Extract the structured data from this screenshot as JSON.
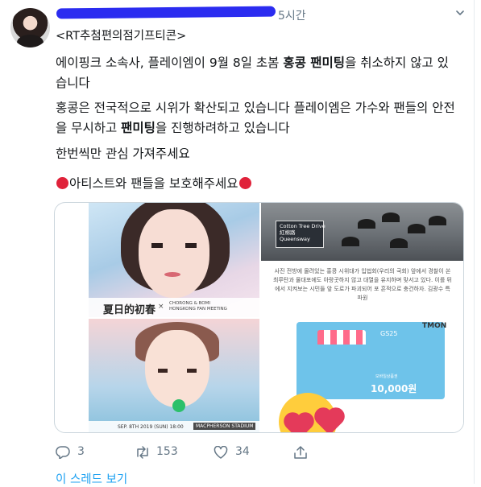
{
  "tweet": {
    "time": "5시간",
    "handle": "<RT추첨편의점기프티콘>",
    "paragraphs": [
      [
        "에이핑크 소속사, 플레이엠이 9월 8일 초봄 ",
        "홍콩 팬미팅",
        "을 취소하지 않고 있습니다"
      ],
      [
        "홍콩은 전국적으로 시위가 확산되고 있습니다 플레이엠은 가수와 팬들의 안전을 무시하고 ",
        "팬미팅",
        "을 진행하려하고 있습니다"
      ],
      [
        "한번씩만 관심 가져주세요"
      ]
    ],
    "protect_line": "아티스트와 팬들을 보호해주세요",
    "media": {
      "poster_title_cn": "夏日的初春",
      "poster_x": "×",
      "poster_subtitle": "CHORONG & BOMI\nHONGKONG FAN MEETING",
      "poster_date": "SEP. 8TH 2019 (SUN) 18:00",
      "poster_venue": "MACPHERSON STADIUM",
      "street_sign": "Cotton Tree Drive\n紅棉路\nQueensway",
      "news_caption": "사진 전방에 몰려있는 홍콩 시위대가 입법회(우리의 국회) 앞에서 경찰이 쏜 최루탄과 물대포에도 아랑곳하지 않고 대열을 유지하며 맞서고 있다. 이를 뒤에서 지켜보는 시민들 앞 도로가 파괴되어 포 흔적으로 충건하자. 김광수 특파원",
      "tmon": "TMON",
      "gs_label": "GS25",
      "amount_label": "모바일상품권",
      "amount": "10,000원"
    },
    "actions": {
      "replies": "3",
      "retweets": "153",
      "likes": "34"
    },
    "show_thread": "이 스레드 보기"
  },
  "colors": {
    "text": "#14171a",
    "muted": "#657786",
    "link": "#1da1f2",
    "redacted_scribble": "#2b2cf0",
    "red_circle": "#e0223a"
  },
  "icons": [
    "reply-icon",
    "retweet-icon",
    "like-icon",
    "share-icon",
    "chevron-down-icon",
    "red-circle-icon"
  ]
}
